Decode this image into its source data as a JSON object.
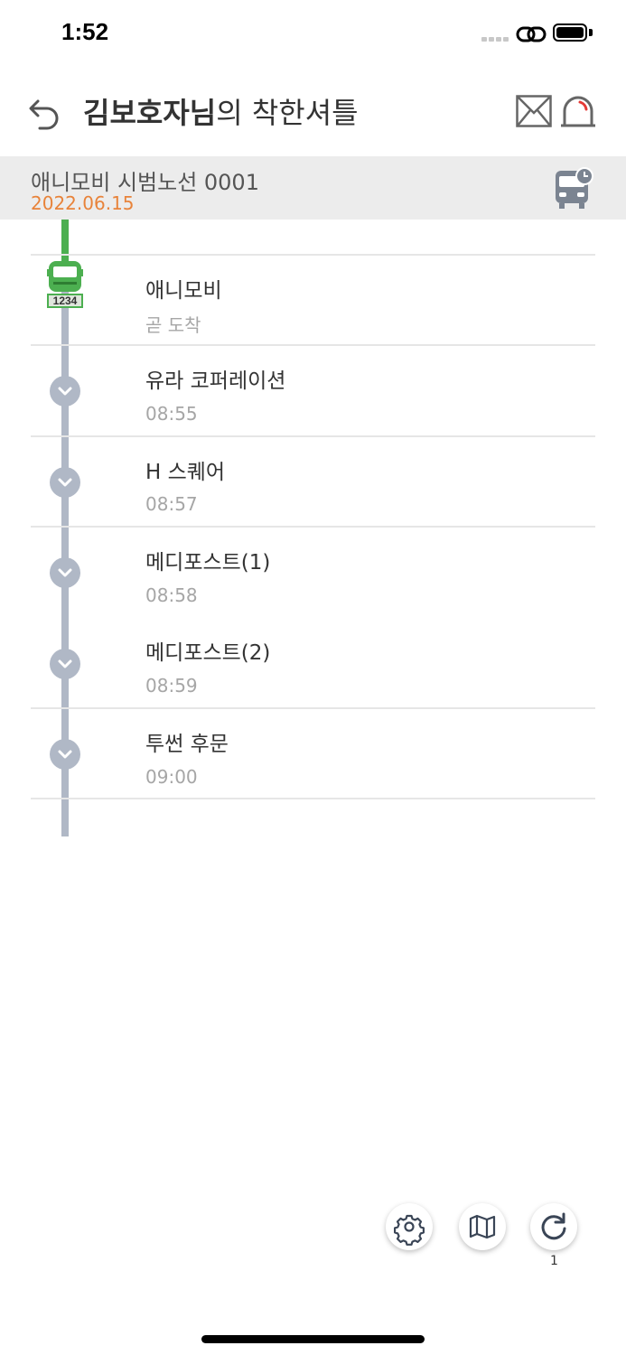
{
  "status_bar": {
    "time": "1:52"
  },
  "header": {
    "title_bold": "김보호자님",
    "title_rest": "의 착한셔틀"
  },
  "route": {
    "name": "애니모비 시범노선 0001",
    "date": "2022.06.15"
  },
  "bus": {
    "number": "1234"
  },
  "stops": [
    {
      "name": "애니모비",
      "time": "곧 도착"
    },
    {
      "name": "유라 코퍼레이션",
      "time": "08:55"
    },
    {
      "name": "H 스퀘어",
      "time": "08:57"
    },
    {
      "name": "메디포스트(1)",
      "time": "08:58"
    },
    {
      "name": "메디포스트(2)",
      "time": "08:59"
    },
    {
      "name": "투썬 후문",
      "time": "09:00"
    }
  ],
  "bottom": {
    "refresh_count": "1"
  },
  "colors": {
    "accent_green": "#4caf50",
    "date_orange": "#e8833a",
    "timeline_gray": "#b0b8c6"
  }
}
